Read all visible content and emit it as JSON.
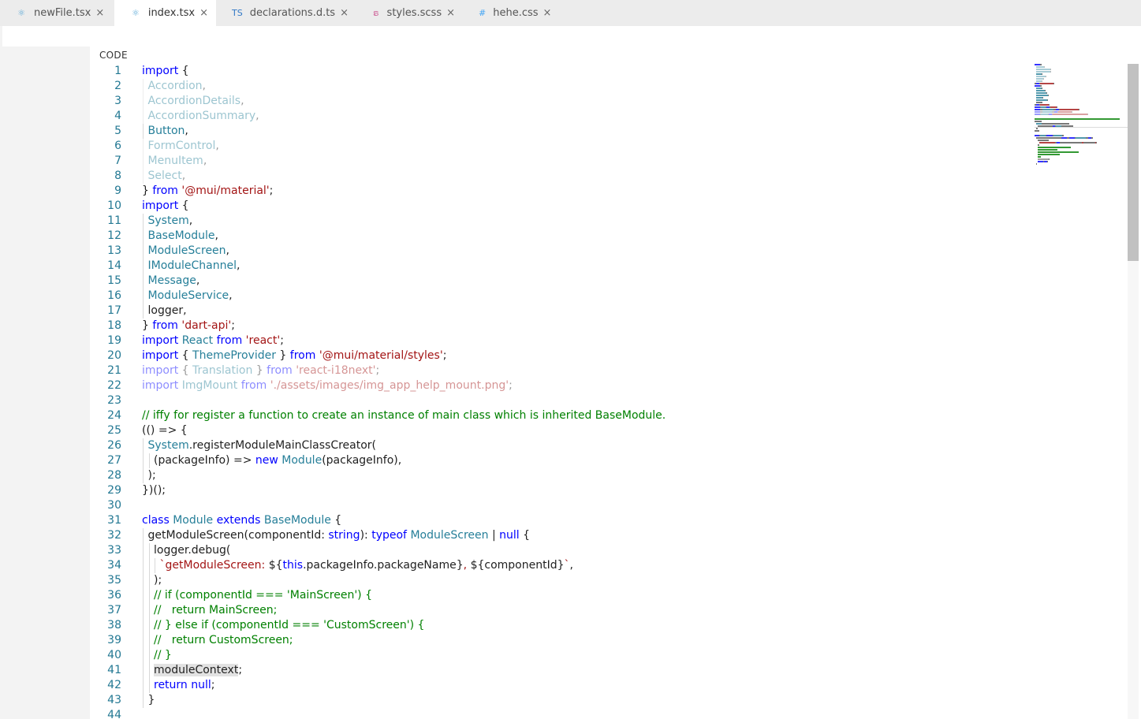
{
  "tabs": [
    {
      "label": "newFile.tsx",
      "icon": "react-icon",
      "glyph": "⚛",
      "color": "#5aa8d6",
      "active": false
    },
    {
      "label": "index.tsx",
      "icon": "react-icon",
      "glyph": "⚛",
      "color": "#5aa8d6",
      "active": true
    },
    {
      "label": "declarations.d.ts",
      "icon": "typescript-icon",
      "glyph": "TS",
      "color": "#3178c6",
      "active": false
    },
    {
      "label": "styles.scss",
      "icon": "sass-icon",
      "glyph": "ຣ",
      "color": "#cf649a",
      "active": false
    },
    {
      "label": "hehe.css",
      "icon": "css-icon",
      "glyph": "#",
      "color": "#42a5f5",
      "active": false
    }
  ],
  "close_glyph": "×",
  "editor": {
    "header": "CODE"
  },
  "colors": {
    "keyword": "#0000ff",
    "type": "#267f99",
    "string": "#a31515",
    "comment": "#008000",
    "line_number": "#237893"
  },
  "code": [
    {
      "n": "1",
      "indent": 0,
      "tokens": [
        {
          "t": "import",
          "c": "kw"
        },
        {
          "t": " {",
          "c": ""
        }
      ]
    },
    {
      "n": "2",
      "indent": 1,
      "fade": true,
      "tokens": [
        {
          "t": "Accordion",
          "c": "ty"
        },
        {
          "t": ",",
          "c": ""
        }
      ]
    },
    {
      "n": "3",
      "indent": 1,
      "fade": true,
      "tokens": [
        {
          "t": "AccordionDetails",
          "c": "ty"
        },
        {
          "t": ",",
          "c": ""
        }
      ]
    },
    {
      "n": "4",
      "indent": 1,
      "fade": true,
      "tokens": [
        {
          "t": "AccordionSummary",
          "c": "ty"
        },
        {
          "t": ",",
          "c": ""
        }
      ]
    },
    {
      "n": "5",
      "indent": 1,
      "tokens": [
        {
          "t": "Button",
          "c": "ty"
        },
        {
          "t": ",",
          "c": ""
        }
      ]
    },
    {
      "n": "6",
      "indent": 1,
      "fade": true,
      "tokens": [
        {
          "t": "FormControl",
          "c": "ty"
        },
        {
          "t": ",",
          "c": ""
        }
      ]
    },
    {
      "n": "7",
      "indent": 1,
      "fade": true,
      "tokens": [
        {
          "t": "MenuItem",
          "c": "ty"
        },
        {
          "t": ",",
          "c": ""
        }
      ]
    },
    {
      "n": "8",
      "indent": 1,
      "fade": true,
      "tokens": [
        {
          "t": "Select",
          "c": "ty"
        },
        {
          "t": ",",
          "c": ""
        }
      ]
    },
    {
      "n": "9",
      "indent": 0,
      "tokens": [
        {
          "t": "} ",
          "c": ""
        },
        {
          "t": "from",
          "c": "kw"
        },
        {
          "t": " ",
          "c": ""
        },
        {
          "t": "'@mui/material'",
          "c": "st"
        },
        {
          "t": ";",
          "c": ""
        }
      ]
    },
    {
      "n": "10",
      "indent": 0,
      "tokens": [
        {
          "t": "import",
          "c": "kw"
        },
        {
          "t": " {",
          "c": ""
        }
      ]
    },
    {
      "n": "11",
      "indent": 1,
      "tokens": [
        {
          "t": "System",
          "c": "ty"
        },
        {
          "t": ",",
          "c": ""
        }
      ]
    },
    {
      "n": "12",
      "indent": 1,
      "tokens": [
        {
          "t": "BaseModule",
          "c": "ty"
        },
        {
          "t": ",",
          "c": ""
        }
      ]
    },
    {
      "n": "13",
      "indent": 1,
      "tokens": [
        {
          "t": "ModuleScreen",
          "c": "ty"
        },
        {
          "t": ",",
          "c": ""
        }
      ]
    },
    {
      "n": "14",
      "indent": 1,
      "tokens": [
        {
          "t": "IModuleChannel",
          "c": "ty"
        },
        {
          "t": ",",
          "c": ""
        }
      ]
    },
    {
      "n": "15",
      "indent": 1,
      "tokens": [
        {
          "t": "Message",
          "c": "ty"
        },
        {
          "t": ",",
          "c": ""
        }
      ]
    },
    {
      "n": "16",
      "indent": 1,
      "tokens": [
        {
          "t": "ModuleService",
          "c": "ty"
        },
        {
          "t": ",",
          "c": ""
        }
      ]
    },
    {
      "n": "17",
      "indent": 1,
      "tokens": [
        {
          "t": "logger,",
          "c": ""
        }
      ]
    },
    {
      "n": "18",
      "indent": 0,
      "tokens": [
        {
          "t": "} ",
          "c": ""
        },
        {
          "t": "from",
          "c": "kw"
        },
        {
          "t": " ",
          "c": ""
        },
        {
          "t": "'dart-api'",
          "c": "st"
        },
        {
          "t": ";",
          "c": ""
        }
      ]
    },
    {
      "n": "19",
      "indent": 0,
      "tokens": [
        {
          "t": "import",
          "c": "kw"
        },
        {
          "t": " ",
          "c": ""
        },
        {
          "t": "React",
          "c": "ty"
        },
        {
          "t": " ",
          "c": ""
        },
        {
          "t": "from",
          "c": "kw"
        },
        {
          "t": " ",
          "c": ""
        },
        {
          "t": "'react'",
          "c": "st"
        },
        {
          "t": ";",
          "c": ""
        }
      ]
    },
    {
      "n": "20",
      "indent": 0,
      "tokens": [
        {
          "t": "import",
          "c": "kw"
        },
        {
          "t": " { ",
          "c": ""
        },
        {
          "t": "ThemeProvider",
          "c": "ty"
        },
        {
          "t": " } ",
          "c": ""
        },
        {
          "t": "from",
          "c": "kw"
        },
        {
          "t": " ",
          "c": ""
        },
        {
          "t": "'@mui/material/styles'",
          "c": "st"
        },
        {
          "t": ";",
          "c": ""
        }
      ]
    },
    {
      "n": "21",
      "indent": 0,
      "fade": true,
      "tokens": [
        {
          "t": "import",
          "c": "kw"
        },
        {
          "t": " { ",
          "c": ""
        },
        {
          "t": "Translation",
          "c": "ty"
        },
        {
          "t": " } ",
          "c": ""
        },
        {
          "t": "from",
          "c": "kw"
        },
        {
          "t": " ",
          "c": ""
        },
        {
          "t": "'react-i18next'",
          "c": "st"
        },
        {
          "t": ";",
          "c": ""
        }
      ]
    },
    {
      "n": "22",
      "indent": 0,
      "fade": true,
      "tokens": [
        {
          "t": "import",
          "c": "kw"
        },
        {
          "t": " ",
          "c": ""
        },
        {
          "t": "ImgMount",
          "c": "ty"
        },
        {
          "t": " ",
          "c": ""
        },
        {
          "t": "from",
          "c": "kw"
        },
        {
          "t": " ",
          "c": ""
        },
        {
          "t": "'./assets/images/img_app_help_mount.png'",
          "c": "st"
        },
        {
          "t": ";",
          "c": ""
        }
      ]
    },
    {
      "n": "23",
      "indent": 0,
      "tokens": []
    },
    {
      "n": "24",
      "indent": 0,
      "tokens": [
        {
          "t": "// iffy for register a function to create an instance of main class which is inherited BaseModule.",
          "c": "cm"
        }
      ]
    },
    {
      "n": "25",
      "indent": 0,
      "tokens": [
        {
          "t": "(() => {",
          "c": ""
        }
      ]
    },
    {
      "n": "26",
      "indent": 1,
      "tokens": [
        {
          "t": "System",
          "c": "ty"
        },
        {
          "t": ".registerModuleMainClassCreator(",
          "c": ""
        }
      ]
    },
    {
      "n": "27",
      "indent": 2,
      "tokens": [
        {
          "t": "(packageInfo) => ",
          "c": ""
        },
        {
          "t": "new",
          "c": "kw"
        },
        {
          "t": " ",
          "c": ""
        },
        {
          "t": "Module",
          "c": "ty"
        },
        {
          "t": "(packageInfo),",
          "c": ""
        }
      ]
    },
    {
      "n": "28",
      "indent": 1,
      "tokens": [
        {
          "t": ");",
          "c": ""
        }
      ]
    },
    {
      "n": "29",
      "indent": 0,
      "tokens": [
        {
          "t": "})();",
          "c": ""
        }
      ]
    },
    {
      "n": "30",
      "indent": 0,
      "tokens": []
    },
    {
      "n": "31",
      "indent": 0,
      "tokens": [
        {
          "t": "class",
          "c": "kw"
        },
        {
          "t": " ",
          "c": ""
        },
        {
          "t": "Module",
          "c": "ty"
        },
        {
          "t": " ",
          "c": ""
        },
        {
          "t": "extends",
          "c": "kw"
        },
        {
          "t": " ",
          "c": ""
        },
        {
          "t": "BaseModule",
          "c": "ty"
        },
        {
          "t": " {",
          "c": ""
        }
      ]
    },
    {
      "n": "32",
      "indent": 1,
      "tokens": [
        {
          "t": "getModuleScreen(componentId: ",
          "c": ""
        },
        {
          "t": "string",
          "c": "kw"
        },
        {
          "t": "): ",
          "c": ""
        },
        {
          "t": "typeof",
          "c": "kw"
        },
        {
          "t": " ",
          "c": ""
        },
        {
          "t": "ModuleScreen",
          "c": "ty"
        },
        {
          "t": " | ",
          "c": ""
        },
        {
          "t": "null",
          "c": "kw"
        },
        {
          "t": " {",
          "c": ""
        }
      ]
    },
    {
      "n": "33",
      "indent": 2,
      "tokens": [
        {
          "t": "logger.debug(",
          "c": ""
        }
      ]
    },
    {
      "n": "34",
      "indent": 3,
      "tokens": [
        {
          "t": "`getModuleScreen: ",
          "c": "st"
        },
        {
          "t": "${",
          "c": ""
        },
        {
          "t": "this",
          "c": "kw"
        },
        {
          "t": ".packageInfo.packageName}",
          "c": ""
        },
        {
          "t": ", ",
          "c": "st"
        },
        {
          "t": "${componentId}",
          "c": ""
        },
        {
          "t": "`",
          "c": "st"
        },
        {
          "t": ",",
          "c": ""
        }
      ]
    },
    {
      "n": "35",
      "indent": 2,
      "tokens": [
        {
          "t": ");",
          "c": ""
        }
      ]
    },
    {
      "n": "36",
      "indent": 2,
      "tokens": [
        {
          "t": "// if (componentId === 'MainScreen') {",
          "c": "cm"
        }
      ]
    },
    {
      "n": "37",
      "indent": 2,
      "tokens": [
        {
          "t": "//   return MainScreen;",
          "c": "cm"
        }
      ]
    },
    {
      "n": "38",
      "indent": 2,
      "tokens": [
        {
          "t": "// } else if (componentId === 'CustomScreen') {",
          "c": "cm"
        }
      ]
    },
    {
      "n": "39",
      "indent": 2,
      "tokens": [
        {
          "t": "//   return CustomScreen;",
          "c": "cm"
        }
      ]
    },
    {
      "n": "40",
      "indent": 2,
      "tokens": [
        {
          "t": "// }",
          "c": "cm"
        }
      ]
    },
    {
      "n": "41",
      "indent": 2,
      "tokens": [
        {
          "t": "moduleContext",
          "c": "hl"
        },
        {
          "t": ";",
          "c": ""
        }
      ]
    },
    {
      "n": "42",
      "indent": 2,
      "tokens": [
        {
          "t": "return",
          "c": "kw"
        },
        {
          "t": " ",
          "c": ""
        },
        {
          "t": "null",
          "c": "kw"
        },
        {
          "t": ";",
          "c": ""
        }
      ]
    },
    {
      "n": "43",
      "indent": 1,
      "tokens": [
        {
          "t": "}",
          "c": ""
        }
      ]
    },
    {
      "n": "44",
      "indent": 0,
      "tokens": []
    }
  ]
}
